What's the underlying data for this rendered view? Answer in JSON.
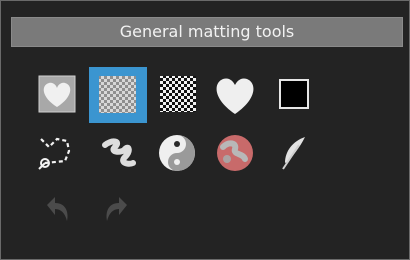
{
  "panel": {
    "title": "General matting tools"
  },
  "tools_row1": [
    {
      "icon": "heart-on-gray-icon",
      "selected": false
    },
    {
      "icon": "transparency-checker-icon",
      "selected": true
    },
    {
      "icon": "checkerboard-icon",
      "selected": false
    },
    {
      "icon": "heart-icon",
      "selected": false
    },
    {
      "icon": "black-square-icon",
      "selected": false
    }
  ],
  "tools_row2": [
    {
      "icon": "polygon-lasso-icon"
    },
    {
      "icon": "smudge-brush-icon"
    },
    {
      "icon": "yin-yang-icon"
    },
    {
      "icon": "red-mask-sphere-icon"
    },
    {
      "icon": "feather-icon"
    }
  ],
  "history": [
    {
      "icon": "undo-icon",
      "enabled": false
    },
    {
      "icon": "redo-icon",
      "enabled": false
    }
  ],
  "colors": {
    "panel_bg": "#232323",
    "header_bg": "#7a7a7a",
    "selected_bg": "#3b95d0",
    "icon_light": "#efefef",
    "icon_disabled": "#4b4b4b"
  }
}
